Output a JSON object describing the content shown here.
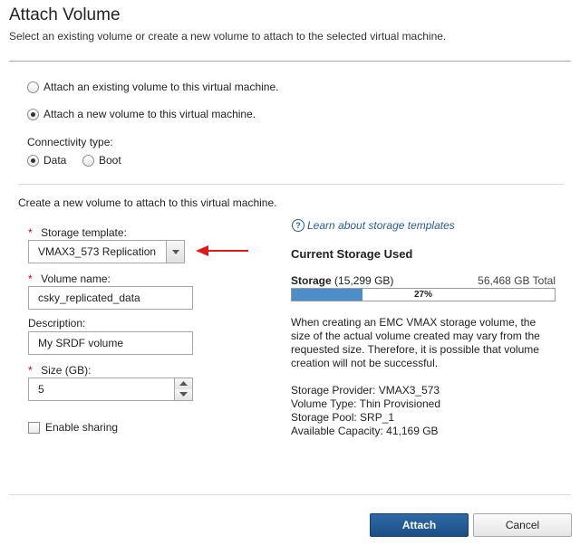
{
  "dialog": {
    "title": "Attach Volume",
    "subtitle": "Select an existing volume or create a new volume to attach to the selected virtual machine."
  },
  "attach_mode": {
    "options": [
      {
        "label": "Attach an existing volume to this virtual machine.",
        "selected": false
      },
      {
        "label": "Attach a new volume to this virtual machine.",
        "selected": true
      }
    ]
  },
  "connectivity": {
    "label": "Connectivity type:",
    "options": [
      {
        "label": "Data",
        "selected": true
      },
      {
        "label": "Boot",
        "selected": false
      }
    ]
  },
  "create_section": {
    "heading": "Create a new volume to attach to this virtual machine.",
    "required_marker": "*",
    "storage_template": {
      "label": "Storage template:",
      "value": "VMAX3_573 Replication"
    },
    "volume_name": {
      "label": "Volume name:",
      "value": "csky_replicated_data"
    },
    "description": {
      "label": "Description:",
      "value": "My SRDF volume"
    },
    "size": {
      "label": "Size (GB):",
      "value": "5"
    },
    "enable_sharing": {
      "label": "Enable sharing",
      "checked": false
    }
  },
  "storage_info": {
    "help_link": "Learn about storage templates",
    "heading": "Current Storage Used",
    "bar_label_bold": "Storage",
    "bar_label_used": "(15,299 GB)",
    "total": "56,468 GB Total",
    "percent_text": "27%",
    "percent_value": 27,
    "bar_color": "#4d8ec9",
    "note_lines": [
      "When creating an EMC VMAX storage volume, the",
      "size of the actual volume created may vary from the",
      "requested size. Therefore, it is possible that volume",
      "creation will not be successful."
    ],
    "details": [
      "Storage Provider: VMAX3_573",
      "Volume Type: Thin Provisioned",
      "Storage Pool: SRP_1",
      "Available Capacity: 41,169 GB"
    ]
  },
  "annotation_arrow_color": "#e01a1a",
  "footer": {
    "attach_label": "Attach",
    "cancel_label": "Cancel"
  }
}
